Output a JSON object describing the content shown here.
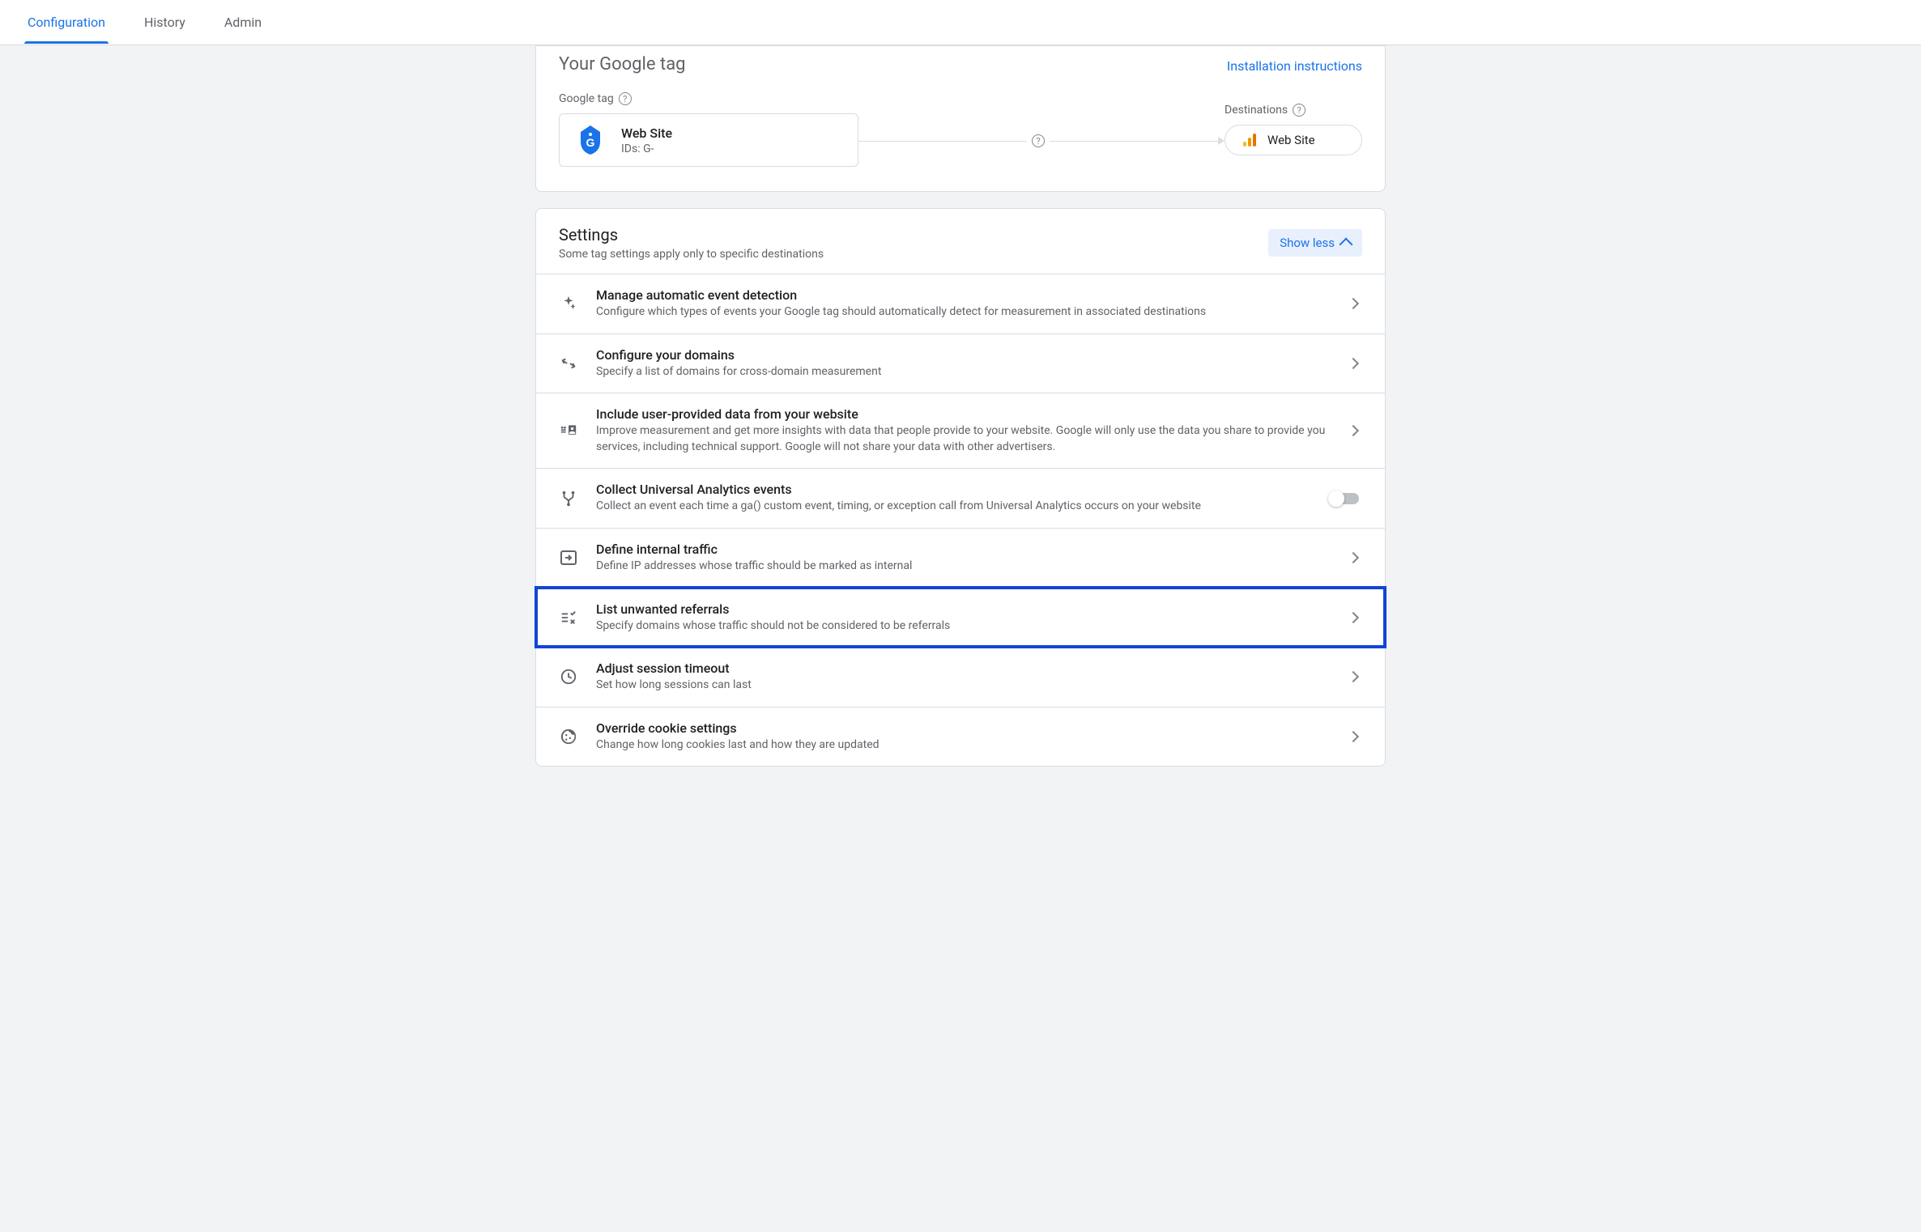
{
  "tabs": {
    "configuration": "Configuration",
    "history": "History",
    "admin": "Admin"
  },
  "tag_card": {
    "title_partial": "Your Google tag",
    "install_link": "Installation instructions",
    "gtag_label": "Google tag",
    "gtag_name": "Web Site",
    "gtag_ids": "IDs: G-",
    "dest_label": "Destinations",
    "dest_name": "Web Site"
  },
  "settings": {
    "title": "Settings",
    "subtitle": "Some tag settings apply only to specific destinations",
    "show_less": "Show less",
    "rows": [
      {
        "title": "Manage automatic event detection",
        "desc": "Configure which types of events your Google tag should automatically detect for measurement in associated destinations"
      },
      {
        "title": "Configure your domains",
        "desc": "Specify a list of domains for cross-domain measurement"
      },
      {
        "title": "Include user-provided data from your website",
        "desc": "Improve measurement and get more insights with data that people provide to your website. Google will only use the data you share to provide you services, including technical support. Google will not share your data with other advertisers."
      },
      {
        "title": "Collect Universal Analytics events",
        "desc": "Collect an event each time a ga() custom event, timing, or exception call from Universal Analytics occurs on your website"
      },
      {
        "title": "Define internal traffic",
        "desc": "Define IP addresses whose traffic should be marked as internal"
      },
      {
        "title": "List unwanted referrals",
        "desc": "Specify domains whose traffic should not be considered to be referrals"
      },
      {
        "title": "Adjust session timeout",
        "desc": "Set how long sessions can last"
      },
      {
        "title": "Override cookie settings",
        "desc": "Change how long cookies last and how they are updated"
      }
    ]
  }
}
